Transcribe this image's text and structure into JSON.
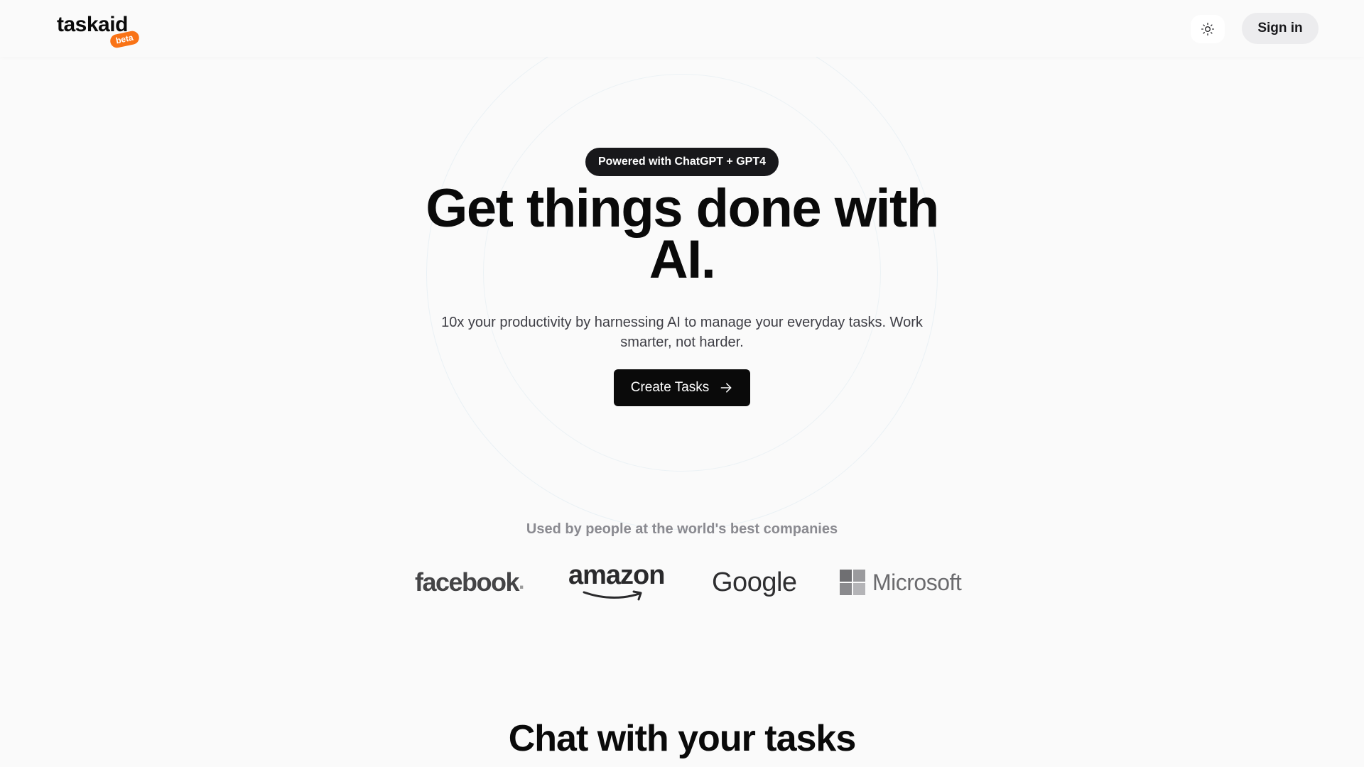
{
  "header": {
    "logo_text": "taskaid",
    "beta_label": "beta",
    "theme_icon": "sun-icon",
    "signin_label": "Sign in"
  },
  "hero": {
    "badge": "Powered with ChatGPT + GPT4",
    "title_line1": "Get things done with",
    "title_line2": "AI.",
    "subtitle_line1": "10x your productivity by harnessing AI to manage your everyday tasks. Work",
    "subtitle_line2": "smarter, not harder.",
    "cta_label": "Create Tasks",
    "cta_icon": "arrow-right-icon"
  },
  "companies": {
    "caption": "Used by people at the world's best companies",
    "logos": [
      {
        "name": "facebook",
        "text": "facebook",
        "suffix": "."
      },
      {
        "name": "amazon",
        "text": "amazon"
      },
      {
        "name": "google",
        "text": "Google"
      },
      {
        "name": "microsoft",
        "text": "Microsoft"
      }
    ]
  },
  "section": {
    "heading": "Chat with your tasks"
  },
  "colors": {
    "background": "#fafafa",
    "beta_badge": "#f97316",
    "dark": "#0a0a0a",
    "signin_bg": "#ececee"
  }
}
